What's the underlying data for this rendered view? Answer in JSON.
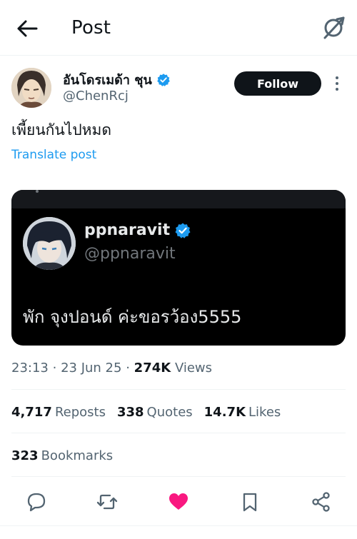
{
  "header": {
    "title": "Post"
  },
  "author": {
    "display_name": "อันโดรเมด้า ชุน",
    "handle": "@ChenRcj",
    "follow_label": "Follow"
  },
  "tweet": {
    "text": "เพี้ยนกันไปหมด",
    "translate_label": "Translate post"
  },
  "embedded": {
    "name": "ppnaravit",
    "handle": "@ppnaravit",
    "text": "พัก จุงปอนด์ ค่ะขอรว้อง5555"
  },
  "meta": {
    "time": "23:13",
    "separator": "·",
    "date": "23 Jun 25",
    "views_count": "274K",
    "views_label": "Views"
  },
  "stats": {
    "reposts_count": "4,717",
    "reposts_label": "Reposts",
    "quotes_count": "338",
    "quotes_label": "Quotes",
    "likes_count": "14.7K",
    "likes_label": "Likes",
    "bookmarks_count": "323",
    "bookmarks_label": "Bookmarks"
  },
  "icons": {
    "back": "arrow-left-icon",
    "grok": "grok-icon",
    "verified": "verified-badge-icon",
    "more": "more-vertical-icon",
    "reply": "reply-icon",
    "repost": "repost-icon",
    "like": "heart-icon",
    "bookmark": "bookmark-icon",
    "share": "share-icon"
  },
  "colors": {
    "accent": "#1d9bf0",
    "liked": "#f91880",
    "text": "#0f1419",
    "muted": "#536471"
  }
}
